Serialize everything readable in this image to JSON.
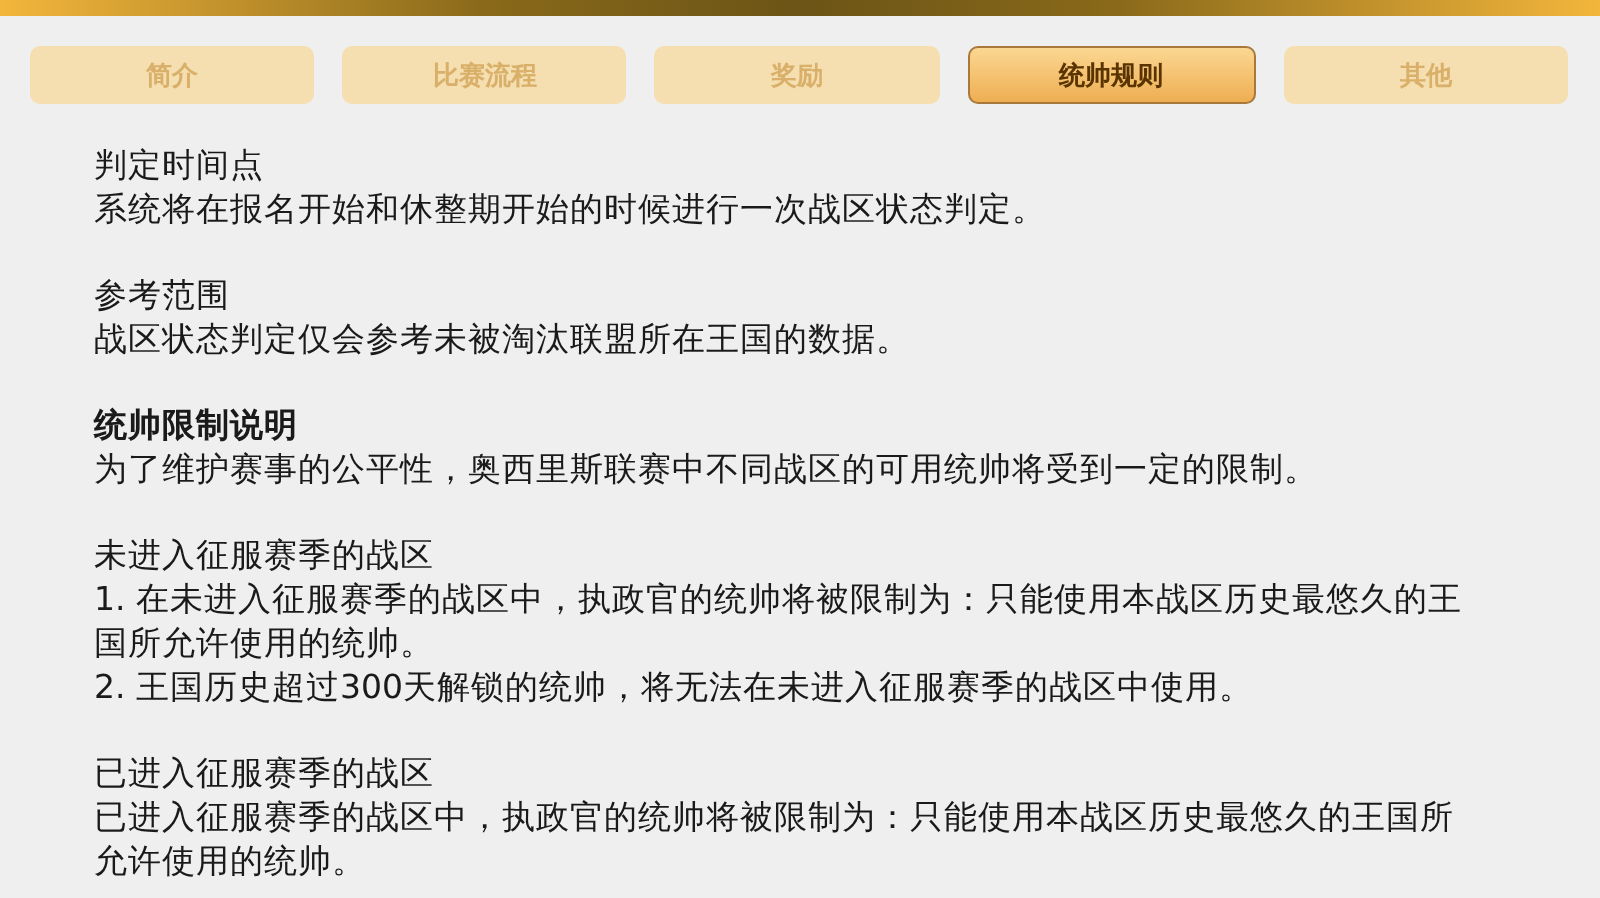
{
  "tabs": [
    {
      "label": "简介",
      "selected": false
    },
    {
      "label": "比赛流程",
      "selected": false
    },
    {
      "label": "奖励",
      "selected": false
    },
    {
      "label": "统帅规则",
      "selected": true
    },
    {
      "label": "其他",
      "selected": false
    }
  ],
  "sections": [
    {
      "title": "判定时间点",
      "title_bold": false,
      "paragraphs": [
        "系统将在报名开始和休整期开始的时候进行一次战区状态判定。"
      ]
    },
    {
      "title": "参考范围",
      "title_bold": false,
      "paragraphs": [
        "战区状态判定仅会参考未被淘汰联盟所在王国的数据。"
      ]
    },
    {
      "title": "统帅限制说明",
      "title_bold": true,
      "paragraphs": [
        "为了维护赛事的公平性，奥西里斯联赛中不同战区的可用统帅将受到一定的限制。"
      ]
    },
    {
      "title": "未进入征服赛季的战区",
      "title_bold": false,
      "paragraphs": [
        "1. 在未进入征服赛季的战区中，执政官的统帅将被限制为：只能使用本战区历史最悠久的王国所允许使用的统帅。",
        "2. 王国历史超过300天解锁的统帅，将无法在未进入征服赛季的战区中使用。"
      ]
    },
    {
      "title": "已进入征服赛季的战区",
      "title_bold": false,
      "paragraphs": [
        "已进入征服赛季的战区中，执政官的统帅将被限制为：只能使用本战区历史最悠久的王国所允许使用的统帅。"
      ]
    }
  ]
}
